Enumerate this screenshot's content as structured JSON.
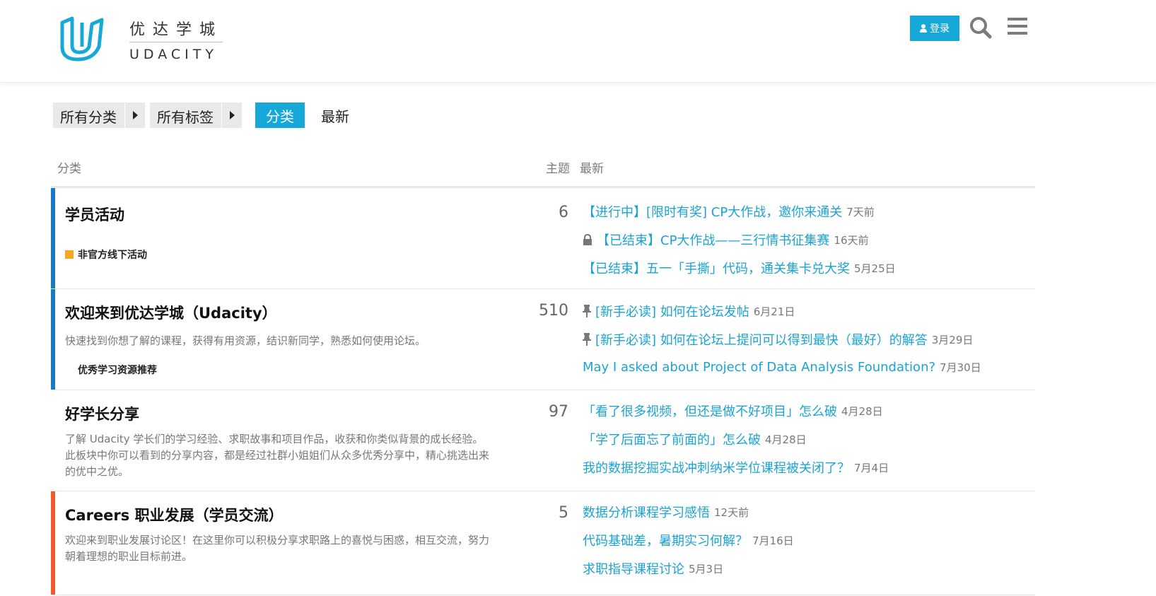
{
  "header": {
    "logo_cn": "优达学城",
    "logo_en": "UDACITY",
    "login_label": "登录",
    "accent": "#16a8d8"
  },
  "nav": {
    "all_categories": "所有分类",
    "all_tags": "所有标签",
    "tab_categories": "分类",
    "tab_latest": "最新"
  },
  "table": {
    "col_category": "分类",
    "col_topics": "主题",
    "col_latest": "最新"
  },
  "categories": [
    {
      "title": "学员活动",
      "color": "#1a7ac1",
      "topics": "6",
      "subcategory": "非官方线下活动",
      "latest": [
        {
          "title": "【进行中】[限时有奖] CP大作战，邀你来通关",
          "time": "7天前",
          "icon": ""
        },
        {
          "title": "【已结束】CP大作战——三行情书征集赛",
          "time": "16天前",
          "icon": "lock-icon"
        },
        {
          "title": "【已结束】五一「手撕」代码，通关集卡兑大奖",
          "time": "5月25日",
          "icon": ""
        }
      ]
    },
    {
      "title": "欢迎来到优达学城（Udacity）",
      "color": "#1a7ac1",
      "topics": "510",
      "description": "快速找到你想了解的课程，获得有用资源，结识新同学，熟悉如何使用论坛。",
      "subcategory": "优秀学习资源推荐",
      "latest": [
        {
          "title": "[新手必读] 如何在论坛发帖",
          "time": "6月21日",
          "icon": "pin-icon"
        },
        {
          "title": "[新手必读] 如何在论坛上提问可以得到最快（最好）的解答",
          "time": "3月29日",
          "icon": "pin-icon"
        },
        {
          "title": "May I asked about Project of Data Analysis Foundation?",
          "time": "7月30日",
          "icon": ""
        }
      ]
    },
    {
      "title": "好学长分享",
      "color": "#ffffff",
      "topics": "97",
      "description": "了解 Udacity 学长们的学习经验、求职故事和项目作品，收获和你类似背景的成长经验。 此板块中你可以看到的分享内容，都是经过社群小姐姐们从众多优秀分享中，精心挑选出来的优中之优。",
      "latest": [
        {
          "title": "「看了很多视频，但还是做不好项目」怎么破",
          "time": "4月28日",
          "icon": ""
        },
        {
          "title": "「学了后面忘了前面的」怎么破",
          "time": "4月28日",
          "icon": ""
        },
        {
          "title": "我的数据挖掘实战冲刺纳米学位课程被关闭了？",
          "time": "7月4日",
          "icon": ""
        }
      ]
    },
    {
      "title": "Careers 职业发展（学员交流）",
      "color": "#f0592a",
      "topics": "5",
      "description": "欢迎来到职业发展讨论区！在这里你可以积极分享求职路上的喜悦与困惑，相互交流，努力朝着理想的职业目标前进。",
      "latest": [
        {
          "title": "数据分析课程学习感悟",
          "time": "12天前",
          "icon": ""
        },
        {
          "title": "代码基础差，暑期实习何解？",
          "time": "7月16日",
          "icon": ""
        },
        {
          "title": "求职指导课程讨论",
          "time": "5月3日",
          "icon": ""
        }
      ]
    }
  ]
}
